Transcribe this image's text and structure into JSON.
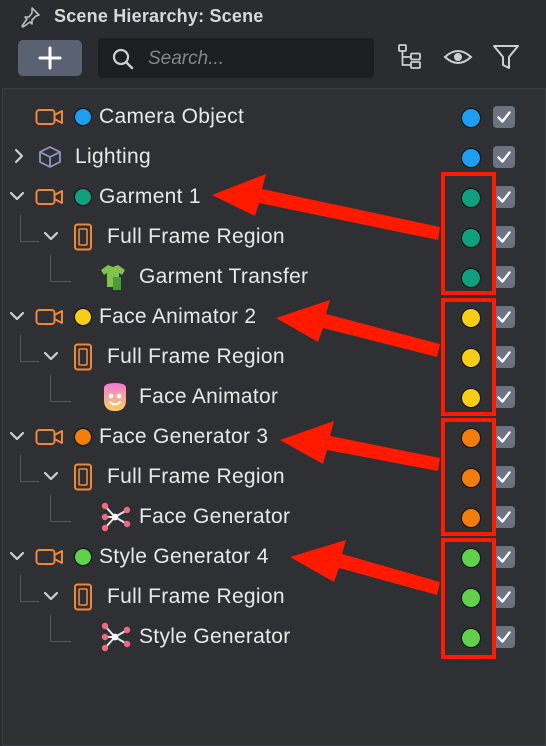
{
  "panel": {
    "title": "Scene Hierarchy: Scene",
    "icons": [
      "pin-icon",
      "plus-icon",
      "search-icon",
      "hierarchy-icon",
      "eye-icon",
      "filter-icon"
    ]
  },
  "search": {
    "placeholder": "Search..."
  },
  "colors": {
    "blue": "#1e9ef0",
    "teal": "#10a07e",
    "yellow": "#f7cd15",
    "orange": "#f27d0c",
    "green": "#5fd14a",
    "annotation_red": "#ff1a00",
    "orange_icon": "#f0883a"
  },
  "tree": {
    "camera_object": "Camera Object",
    "lighting": "Lighting",
    "garment_1": "Garment 1",
    "garment_region": "Full Frame Region",
    "garment_transfer": "Garment Transfer",
    "face_animator_2": "Face Animator 2",
    "face_animator_region": "Full Frame Region",
    "face_animator": "Face Animator",
    "face_generator_3": "Face Generator 3",
    "face_generator_region": "Full Frame Region",
    "face_generator": "Face Generator",
    "style_generator_4": "Style Generator 4",
    "style_generator_region": "Full Frame Region",
    "style_generator": "Style Generator"
  }
}
